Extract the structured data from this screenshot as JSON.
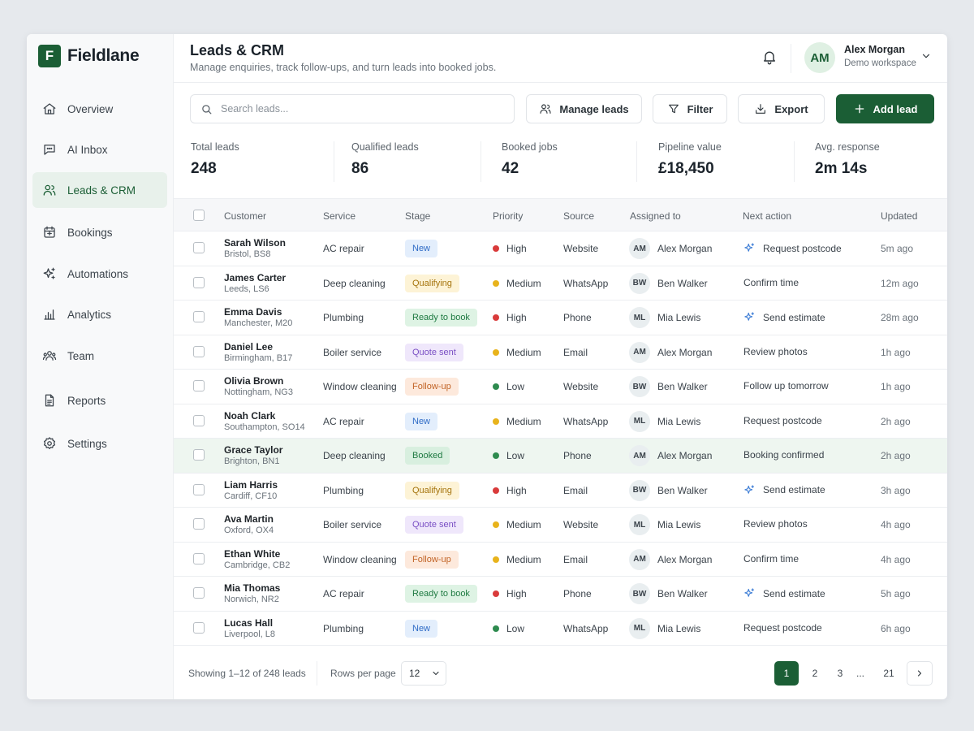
{
  "brand": {
    "logo_letter": "F",
    "name": "Fieldlane",
    "accent": "#1b5e35"
  },
  "sidebar": {
    "items": [
      {
        "label": "Overview",
        "icon": "home-icon"
      },
      {
        "label": "AI Inbox",
        "icon": "chat-icon"
      },
      {
        "label": "Leads & CRM",
        "icon": "users-icon",
        "active": true
      },
      {
        "label": "Bookings",
        "icon": "calendar-icon"
      },
      {
        "label": "Automations",
        "icon": "sparkle-icon"
      },
      {
        "label": "Analytics",
        "icon": "bar-chart-icon"
      },
      {
        "label": "Team",
        "icon": "team-icon"
      },
      {
        "label": "Reports",
        "icon": "document-icon"
      },
      {
        "label": "Settings",
        "icon": "gear-icon"
      }
    ]
  },
  "header": {
    "title": "Leads & CRM",
    "subtitle": "Manage enquiries, track follow-ups, and turn leads into booked jobs.",
    "user": {
      "initials": "AM",
      "name": "Alex Morgan",
      "workspace": "Demo workspace"
    }
  },
  "toolbar": {
    "search_placeholder": "Search leads...",
    "manage_label": "Manage leads",
    "filter_label": "Filter",
    "export_label": "Export",
    "add_label": "Add lead"
  },
  "stats": [
    {
      "label": "Total leads",
      "value": "248"
    },
    {
      "label": "Qualified leads",
      "value": "86"
    },
    {
      "label": "Booked jobs",
      "value": "42"
    },
    {
      "label": "Pipeline value",
      "value": "£18,450"
    },
    {
      "label": "Avg. response",
      "value": "2m 14s"
    }
  ],
  "table": {
    "columns": [
      "Customer",
      "Service",
      "Stage",
      "Priority",
      "Source",
      "Assigned to",
      "Next action",
      "Updated"
    ],
    "priority_colors": {
      "High": "#d93b3b",
      "Medium": "#e8b31c",
      "Low": "#2e8b4f"
    },
    "rows": [
      {
        "name": "Sarah Wilson",
        "location": "Bristol, BS8",
        "service": "AC repair",
        "stage": "New",
        "stage_class": "new",
        "priority": "High",
        "source": "Website",
        "initials": "AM",
        "assignee": "Alex Morgan",
        "next": "Request postcode",
        "ai": true,
        "updated": "5m ago"
      },
      {
        "name": "James Carter",
        "location": "Leeds, LS6",
        "service": "Deep cleaning",
        "stage": "Qualifying",
        "stage_class": "qualifying",
        "priority": "Medium",
        "source": "WhatsApp",
        "initials": "BW",
        "assignee": "Ben Walker",
        "next": "Confirm time",
        "ai": false,
        "updated": "12m ago"
      },
      {
        "name": "Emma Davis",
        "location": "Manchester, M20",
        "service": "Plumbing",
        "stage": "Ready to book",
        "stage_class": "ready",
        "priority": "High",
        "source": "Phone",
        "initials": "ML",
        "assignee": "Mia Lewis",
        "next": "Send estimate",
        "ai": true,
        "updated": "28m ago"
      },
      {
        "name": "Daniel Lee",
        "location": "Birmingham, B17",
        "service": "Boiler service",
        "stage": "Quote sent",
        "stage_class": "quote",
        "priority": "Medium",
        "source": "Email",
        "initials": "AM",
        "assignee": "Alex Morgan",
        "next": "Review photos",
        "ai": false,
        "updated": "1h ago"
      },
      {
        "name": "Olivia Brown",
        "location": "Nottingham, NG3",
        "service": "Window cleaning",
        "stage": "Follow-up",
        "stage_class": "follow",
        "priority": "Low",
        "source": "Website",
        "initials": "BW",
        "assignee": "Ben Walker",
        "next": "Follow up tomorrow",
        "ai": false,
        "updated": "1h ago"
      },
      {
        "name": "Noah Clark",
        "location": "Southampton, SO14",
        "service": "AC repair",
        "stage": "New",
        "stage_class": "new",
        "priority": "Medium",
        "source": "WhatsApp",
        "initials": "ML",
        "assignee": "Mia Lewis",
        "next": "Request postcode",
        "ai": false,
        "updated": "2h ago"
      },
      {
        "name": "Grace Taylor",
        "location": "Brighton, BN1",
        "service": "Deep cleaning",
        "stage": "Booked",
        "stage_class": "booked",
        "priority": "Low",
        "source": "Phone",
        "initials": "AM",
        "assignee": "Alex Morgan",
        "next": "Booking confirmed",
        "ai": false,
        "updated": "2h ago",
        "highlighted": true
      },
      {
        "name": "Liam Harris",
        "location": "Cardiff, CF10",
        "service": "Plumbing",
        "stage": "Qualifying",
        "stage_class": "qualifying",
        "priority": "High",
        "source": "Email",
        "initials": "BW",
        "assignee": "Ben Walker",
        "next": "Send estimate",
        "ai": true,
        "updated": "3h ago"
      },
      {
        "name": "Ava Martin",
        "location": "Oxford, OX4",
        "service": "Boiler service",
        "stage": "Quote sent",
        "stage_class": "quote",
        "priority": "Medium",
        "source": "Website",
        "initials": "ML",
        "assignee": "Mia Lewis",
        "next": "Review photos",
        "ai": false,
        "updated": "4h ago"
      },
      {
        "name": "Ethan White",
        "location": "Cambridge, CB2",
        "service": "Window cleaning",
        "stage": "Follow-up",
        "stage_class": "follow",
        "priority": "Medium",
        "source": "Email",
        "initials": "AM",
        "assignee": "Alex Morgan",
        "next": "Confirm time",
        "ai": false,
        "updated": "4h ago"
      },
      {
        "name": "Mia Thomas",
        "location": "Norwich, NR2",
        "service": "AC repair",
        "stage": "Ready to book",
        "stage_class": "ready",
        "priority": "High",
        "source": "Phone",
        "initials": "BW",
        "assignee": "Ben Walker",
        "next": "Send estimate",
        "ai": true,
        "updated": "5h ago"
      },
      {
        "name": "Lucas Hall",
        "location": "Liverpool, L8",
        "service": "Plumbing",
        "stage": "New",
        "stage_class": "new",
        "priority": "Low",
        "source": "WhatsApp",
        "initials": "ML",
        "assignee": "Mia Lewis",
        "next": "Request postcode",
        "ai": false,
        "updated": "6h ago"
      }
    ]
  },
  "footer": {
    "showing": "Showing 1–12 of 248 leads",
    "rows_per_page_label": "Rows per page",
    "rows_per_page_value": "12",
    "pages": [
      "1",
      "2",
      "3",
      "...",
      "21"
    ],
    "current_page": "1"
  }
}
